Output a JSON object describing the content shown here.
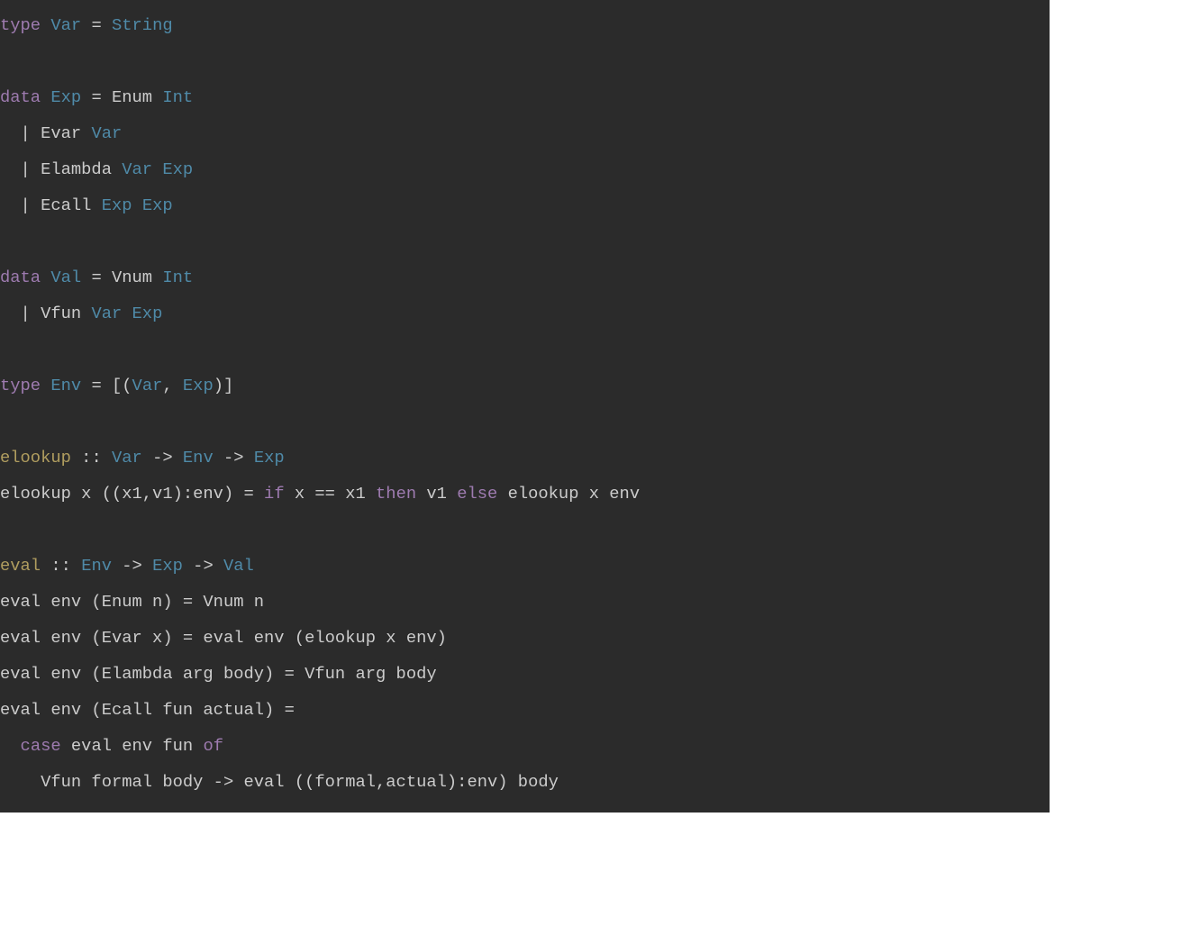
{
  "code": {
    "lines": [
      [
        {
          "t": "type",
          "c": "kw"
        },
        {
          "t": " "
        },
        {
          "t": "Var",
          "c": "type"
        },
        {
          "t": " = "
        },
        {
          "t": "String",
          "c": "type"
        }
      ],
      [],
      [
        {
          "t": "data",
          "c": "kw"
        },
        {
          "t": " "
        },
        {
          "t": "Exp",
          "c": "type"
        },
        {
          "t": " = Enum "
        },
        {
          "t": "Int",
          "c": "type"
        }
      ],
      [
        {
          "t": "  | Evar "
        },
        {
          "t": "Var",
          "c": "type"
        }
      ],
      [
        {
          "t": "  | Elambda "
        },
        {
          "t": "Var",
          "c": "type"
        },
        {
          "t": " "
        },
        {
          "t": "Exp",
          "c": "type"
        }
      ],
      [
        {
          "t": "  | Ecall "
        },
        {
          "t": "Exp",
          "c": "type"
        },
        {
          "t": " "
        },
        {
          "t": "Exp",
          "c": "type"
        }
      ],
      [],
      [
        {
          "t": "data",
          "c": "kw"
        },
        {
          "t": " "
        },
        {
          "t": "Val",
          "c": "type"
        },
        {
          "t": " = Vnum "
        },
        {
          "t": "Int",
          "c": "type"
        }
      ],
      [
        {
          "t": "  | Vfun "
        },
        {
          "t": "Var",
          "c": "type"
        },
        {
          "t": " "
        },
        {
          "t": "Exp",
          "c": "type"
        }
      ],
      [],
      [
        {
          "t": "type",
          "c": "kw"
        },
        {
          "t": " "
        },
        {
          "t": "Env",
          "c": "type"
        },
        {
          "t": " = [("
        },
        {
          "t": "Var",
          "c": "type"
        },
        {
          "t": ", "
        },
        {
          "t": "Exp",
          "c": "type"
        },
        {
          "t": ")]"
        }
      ],
      [],
      [
        {
          "t": "elookup",
          "c": "fn"
        },
        {
          "t": " :: "
        },
        {
          "t": "Var",
          "c": "type"
        },
        {
          "t": " -> "
        },
        {
          "t": "Env",
          "c": "type"
        },
        {
          "t": " -> "
        },
        {
          "t": "Exp",
          "c": "type"
        }
      ],
      [
        {
          "t": "elookup x ((x1,v1):env) = "
        },
        {
          "t": "if",
          "c": "kw"
        },
        {
          "t": " x == x1 "
        },
        {
          "t": "then",
          "c": "kw"
        },
        {
          "t": " v1 "
        },
        {
          "t": "else",
          "c": "kw"
        },
        {
          "t": " elookup x env"
        }
      ],
      [],
      [
        {
          "t": "eval",
          "c": "fn"
        },
        {
          "t": " :: "
        },
        {
          "t": "Env",
          "c": "type"
        },
        {
          "t": " -> "
        },
        {
          "t": "Exp",
          "c": "type"
        },
        {
          "t": " -> "
        },
        {
          "t": "Val",
          "c": "type"
        }
      ],
      [
        {
          "t": "eval env (Enum n) = Vnum n"
        }
      ],
      [
        {
          "t": "eval env (Evar x) = eval env (elookup x env)"
        }
      ],
      [
        {
          "t": "eval env (Elambda arg body) = Vfun arg body"
        }
      ],
      [
        {
          "t": "eval env (Ecall fun actual) ="
        }
      ],
      [
        {
          "t": "  "
        },
        {
          "t": "case",
          "c": "kw"
        },
        {
          "t": " eval env fun "
        },
        {
          "t": "of",
          "c": "kw"
        }
      ],
      [
        {
          "t": "    Vfun formal body -> eval ((formal,actual):env) body"
        }
      ]
    ]
  }
}
